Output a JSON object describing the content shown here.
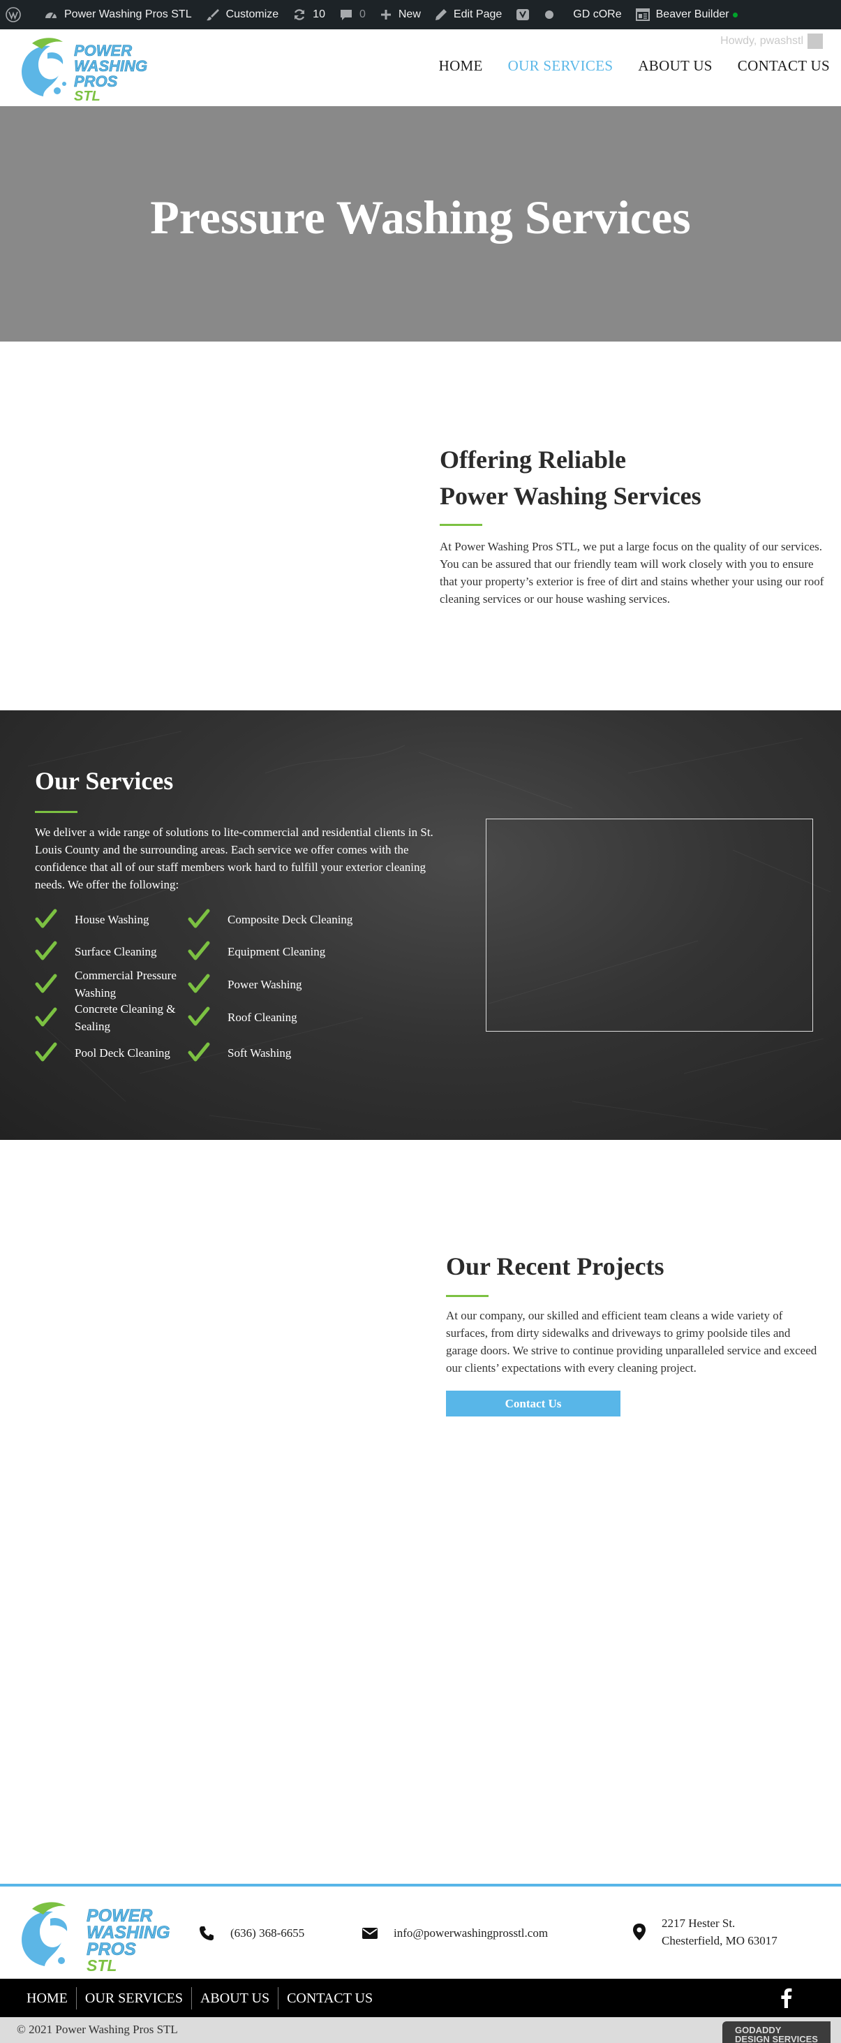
{
  "admin_bar": {
    "site_name": "Power Washing Pros STL",
    "customize": "Customize",
    "updates": "10",
    "comments": "0",
    "new": "New",
    "edit_page": "Edit Page",
    "gd": "GD cORe",
    "builder": "Beaver Builder"
  },
  "header": {
    "greeting": "Howdy, pwashstl",
    "logo_text": [
      "POWER",
      "WASHING",
      "PROS",
      "STL"
    ],
    "nav": [
      {
        "label": "HOME",
        "active": false
      },
      {
        "label": "OUR SERVICES",
        "active": true
      },
      {
        "label": "ABOUT US",
        "active": false
      },
      {
        "label": "CONTACT US",
        "active": false
      }
    ]
  },
  "hero": {
    "title": "Pressure Washing Services"
  },
  "intro": {
    "heading_line1": "Offering Reliable",
    "heading_line2": "Power Washing Services",
    "body": "At Power Washing Pros STL, we put a large focus on the quality of our services. You can be assured that our friendly team will work closely with you to ensure that your property’s exterior is free of dirt and stains whether your using our roof cleaning services or our house washing services."
  },
  "services": {
    "heading": "Our Services",
    "body": "We deliver a wide range of solutions to lite-commercial and residential clients in St. Louis County and the surrounding areas. Each service we offer comes with the confidence that all of our staff members work hard to fulfill your exterior cleaning needs. We offer the following:",
    "left_list": [
      "House Washing",
      "Surface Cleaning",
      "Commercial Pressure Washing",
      "Concrete Cleaning & Sealing",
      "Pool Deck Cleaning"
    ],
    "right_list": [
      "Composite Deck Cleaning",
      "Equipment Cleaning",
      "Power Washing",
      "Roof Cleaning",
      "Soft Washing"
    ]
  },
  "projects": {
    "heading": "Our Recent Projects",
    "body": "At our company, our skilled and efficient team cleans a wide variety of surfaces, from dirty sidewalks and driveways to grimy poolside tiles and garage doors. We strive to continue providing unparalleled service and exceed our clients’ expectations with every cleaning project.",
    "button": "Contact Us"
  },
  "footer": {
    "phone": "(636) 368-6655",
    "email": "info@powerwashingprosstl.com",
    "address_line1": "2217 Hester St.",
    "address_line2": "Chesterfield, MO 63017",
    "nav": [
      "HOME",
      "OUR SERVICES",
      "ABOUT US",
      "CONTACT US"
    ],
    "copyright": "© 2021 Power Washing Pros STL",
    "badge_line1": "GODADDY",
    "badge_line2": "DESIGN SERVICES"
  },
  "colors": {
    "accent_blue": "#58b6e8",
    "accent_green": "#7cc142",
    "admin_bar": "#1d2327"
  }
}
